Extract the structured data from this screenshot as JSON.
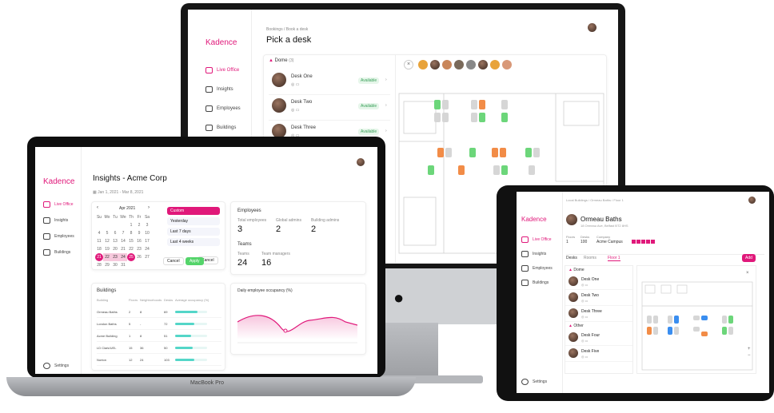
{
  "brand": "Kadence",
  "imac": {
    "breadcrumb": "Bookings / Book a desk",
    "title": "Pick a desk",
    "zone": "Dome",
    "zone_count": "(3)",
    "desks": [
      {
        "name": "Desk One",
        "status": "Available"
      },
      {
        "name": "Desk Two",
        "status": "Available"
      },
      {
        "name": "Desk Three",
        "status": "Available"
      }
    ],
    "nav": [
      "Live Office",
      "Insights",
      "Employees",
      "Buildings"
    ]
  },
  "laptop": {
    "title": "Insights - Acme Corp",
    "daterange": "Jan 1, 2021 - Mar 8, 2021",
    "month": "Apr 2021",
    "weekdays": [
      "Su",
      "Mo",
      "Tu",
      "We",
      "Th",
      "Fr",
      "Sa"
    ],
    "presets": [
      "Custom",
      "Yesterday",
      "Last 7 days",
      "Last 4 weeks"
    ],
    "cancel": "Cancel",
    "apply": "Apply",
    "nav": [
      "Live Office",
      "Insights",
      "Employees",
      "Buildings"
    ],
    "settings": "Settings",
    "employees_title": "Employees",
    "emp_labels": [
      "Total employees",
      "Global admins",
      "Building admins"
    ],
    "emp_values": [
      "3",
      "2",
      "2"
    ],
    "teams_title": "Teams",
    "team_labels": [
      "Teams",
      "Team managers"
    ],
    "team_values": [
      "24",
      "16"
    ],
    "buildings_title": "Buildings",
    "building_cols": [
      "Building",
      "Floors",
      "Neighborhoods",
      "Desks",
      "Average occupancy (%)"
    ],
    "buildings": [
      {
        "name": "Ormeau Baths",
        "floors": "2",
        "nb": "8",
        "desks": "69",
        "occ": 0.7
      },
      {
        "name": "London Baths",
        "floors": "5",
        "nb": "-",
        "desks": "72",
        "occ": 0.6
      },
      {
        "name": "Acme Building",
        "floors": "1",
        "nb": "8",
        "desks": "51",
        "occ": 0.5
      },
      {
        "name": "LD Clark/UEL",
        "floors": "15",
        "nb": "36",
        "desks": "50",
        "occ": 0.55
      },
      {
        "name": "Norton",
        "floors": "12",
        "nb": "24",
        "desks": "103",
        "occ": 0.6
      }
    ],
    "chart_title": "Daily employee occupancy (%)",
    "macbook": "MacBook Pro"
  },
  "tablet": {
    "breadcrumb": "Local Buildings / Ormeau Baths / Floor 1",
    "title": "Ormeau Baths",
    "address": "18 Ormeau Ave, Belfast BT2 8HS",
    "stats_labels": [
      "Floors",
      "Desks",
      "Company"
    ],
    "stats_values": [
      "1",
      "100",
      "Acme Campus"
    ],
    "tabs": [
      "Desks",
      "Rooms",
      "Floor 1"
    ],
    "add": "Add",
    "nav": [
      "Live Office",
      "Insights",
      "Employees",
      "Buildings"
    ],
    "settings": "Settings",
    "zone1": "Dome",
    "zone2": "Other",
    "desks": [
      "Desk One",
      "Desk Two",
      "Desk Three",
      "Desk Four",
      "Desk Five"
    ]
  },
  "colors": {
    "brand": "#e0187a",
    "available": "#6cd67a",
    "booked": "#f28c47"
  }
}
